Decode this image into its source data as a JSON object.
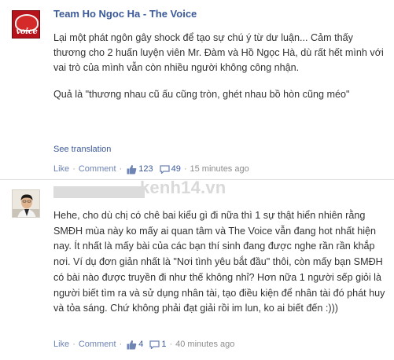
{
  "post": {
    "author": "Team Ho Ngoc Ha - The Voice",
    "avatar_logo": "voice",
    "paragraphs": [
      "Lại một phát ngôn gây shock để tạo sự chú ý từ dư luận... Cảm thấy thương cho 2 huấn luyện viên Mr. Đàm và Hồ Ngọc Hà, dù rất hết mình với vai trò của mình vẫn còn nhiều người không công nhận.",
      "Quả là \"thương nhau cũ ấu cũng tròn, ghét nhau bồ hòn cũng méo\""
    ],
    "see_translation": "See translation",
    "actions": {
      "like": "Like",
      "comment": "Comment",
      "likes_count": "123",
      "comments_count": "49",
      "time": "15 minutes ago",
      "like_icon": "thumbs-up-icon",
      "comment_icon": "comment-bubble-icon"
    }
  },
  "watermark": {
    "text": "kenh14.vn"
  },
  "comment": {
    "text": "Hehe, cho dù chị có chê bai kiểu gì đi nữa thì 1 sự thật hiển nhiên rằng SMĐH mùa này ko mấy ai quan tâm và The Voice vẫn đang hot nhất hiện nay. Ít nhất là mấy bài của các bạn thí sinh đang được nghe rần rần khắp nơi. Ví dụ đơn giản nhất là \"Nơi tình yêu bắt đầu\" thôi, còn mấy bạn SMĐH có bài nào được truyền đi như thế không nhỉ? Hơn nữa 1 người sếp giỏi là người biết tìm ra và sử dụng nhân tài, tạo điều kiện để nhân tài đó phát huy và tỏa sáng. Chứ không phải đạt giải rồi im lun, ko ai biết đến :)))",
    "actions": {
      "like": "Like",
      "comment": "Comment",
      "likes_count": "4",
      "comments_count": "1",
      "time": "40 minutes ago"
    }
  },
  "colors": {
    "link": "#3b5998",
    "meta": "#8c8c8c",
    "text": "#333333",
    "avatar_red": "#b5121b"
  }
}
